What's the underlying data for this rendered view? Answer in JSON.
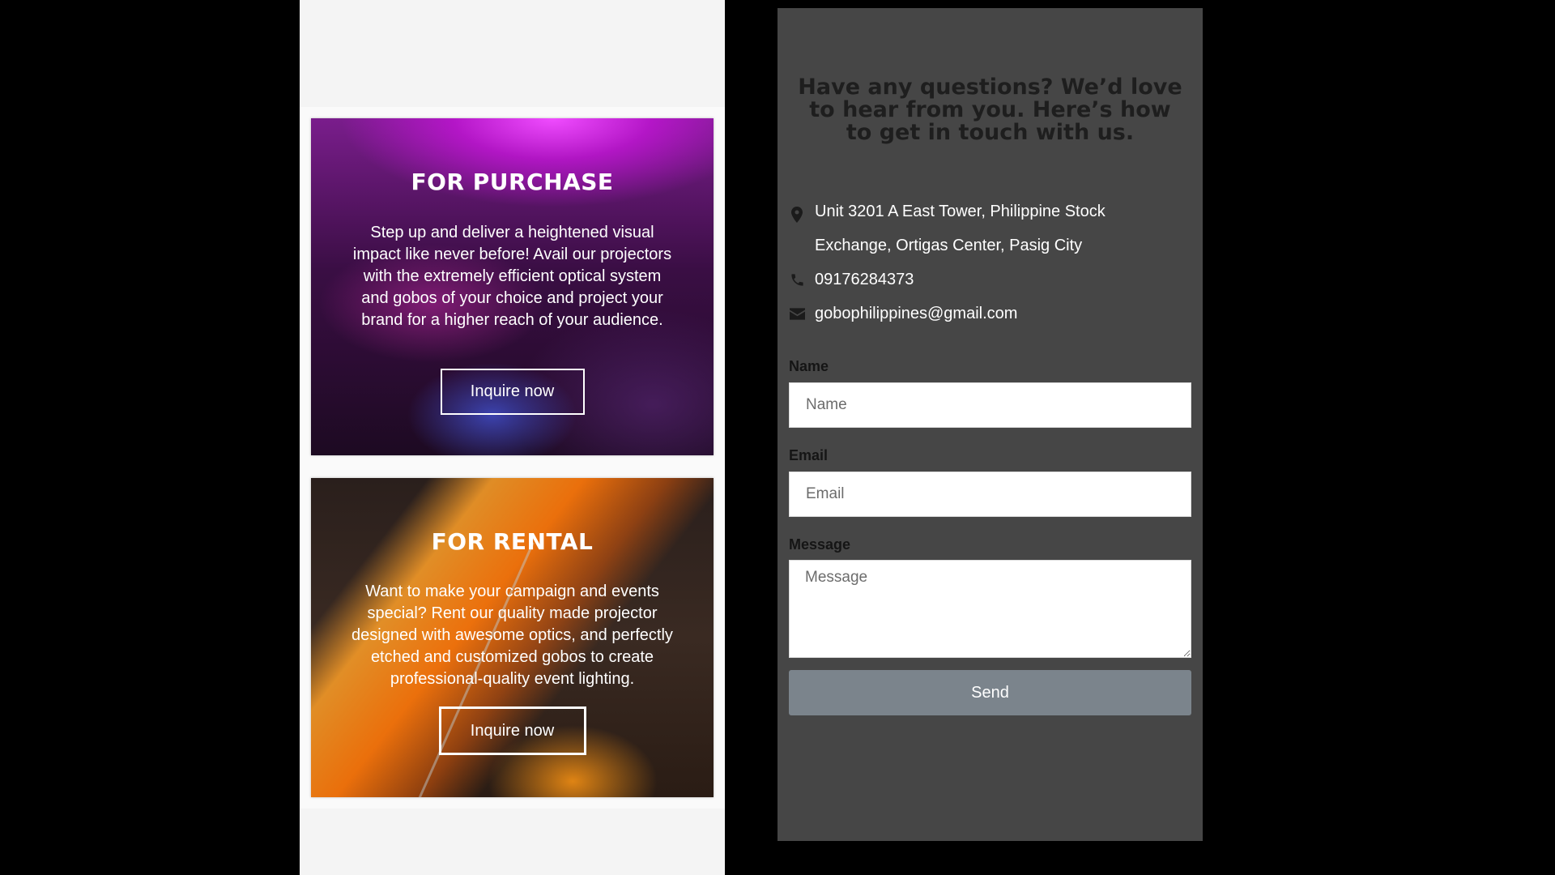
{
  "purchase_card": {
    "title": "FOR PURCHASE",
    "text": "Step up and deliver a heightened visual impact like never before! Avail our projectors with the extremely efficient optical system and gobos of your choice and project your brand for a higher reach of your audience.",
    "button_label": "Inquire now"
  },
  "rental_card": {
    "title": "FOR RENTAL",
    "text": "Want to make your campaign and events special? Rent our quality made projector designed with awesome optics, and perfectly etched and customized gobos to create professional-quality event lighting.",
    "button_label": "Inquire now"
  },
  "contact": {
    "heading": "Have any questions? We’d love to hear from you. Here’s how to get in touch with us.",
    "address_line1": "Unit 3201 A East Tower, Philippine Stock",
    "address_line2": "Exchange, Ortigas Center, Pasig City",
    "phone": "09176284373",
    "email": "gobophilippines@gmail.com",
    "icons": {
      "address": "map-pin-icon",
      "phone": "phone-icon",
      "email": "envelope-icon"
    }
  },
  "form": {
    "name_label": "Name",
    "name_placeholder": "Name",
    "email_label": "Email",
    "email_placeholder": "Email",
    "message_label": "Message",
    "message_placeholder": "Message",
    "send_label": "Send"
  },
  "colors": {
    "page_background": "#000000",
    "left_panel": "#f4f4f4",
    "contact_panel": "#464646",
    "send_button": "#7b848c",
    "heading_text": "#1e1e1e"
  }
}
